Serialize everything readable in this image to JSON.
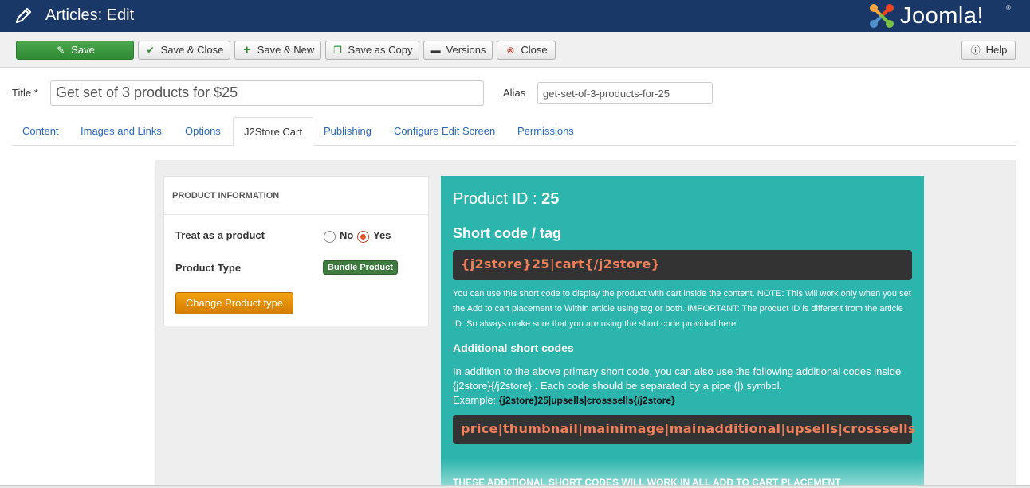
{
  "header": {
    "title": "Articles: Edit",
    "brand": "Joomla!",
    "brand_mark": "®",
    "background": "#1a3867"
  },
  "toolbar": {
    "save": "Save",
    "save_close": "Save & Close",
    "save_new": "Save & New",
    "save_copy": "Save as Copy",
    "versions": "Versions",
    "close": "Close",
    "help": "Help"
  },
  "form": {
    "title_label": "Title *",
    "title_value": "Get set of 3 products for $25",
    "alias_label": "Alias",
    "alias_value": "get-set-of-3-products-for-25"
  },
  "tabs": [
    {
      "label": "Content"
    },
    {
      "label": "Images and Links"
    },
    {
      "label": "Options"
    },
    {
      "label": "J2Store Cart",
      "active": true
    },
    {
      "label": "Publishing"
    },
    {
      "label": "Configure Edit Screen"
    },
    {
      "label": "Permissions"
    }
  ],
  "product_info": {
    "heading": "PRODUCT INFORMATION",
    "treat_label": "Treat as a product",
    "no_label": "No",
    "yes_label": "Yes",
    "treat_selected": "Yes",
    "type_label": "Product Type",
    "type_badge": "Bundle Product",
    "change_button": "Change Product type"
  },
  "shortcode_panel": {
    "id_label": "Product ID :",
    "id_value": "25",
    "shortcode_heading": "Short code / tag",
    "shortcode": "{j2store}25|cart{/j2store}",
    "note": "You can use this short code to display the product with cart inside the content. NOTE: This will work only when you set the Add to cart placement to Within article using tag or both. IMPORTANT: The product ID is different from the article ID. So always make sure that you are using the short code provided here",
    "additional_heading": "Additional short codes",
    "additional_text": "In addition to the above primary short code, you can also use the following additional codes inside {j2store}{/j2store} . Each code should be separated by a pipe (|) symbol.",
    "example_label": "Example:",
    "example_code": "{j2store}25|upsells|crosssells{/j2store}",
    "codes": "price|thumbnail|mainimage|mainadditional|upsells|crosssells",
    "footer_note": "THESE ADDITIONAL SHORT CODES WILL WORK IN ALL ADD TO CART PLACEMENT",
    "background": "#2bb5ad"
  }
}
